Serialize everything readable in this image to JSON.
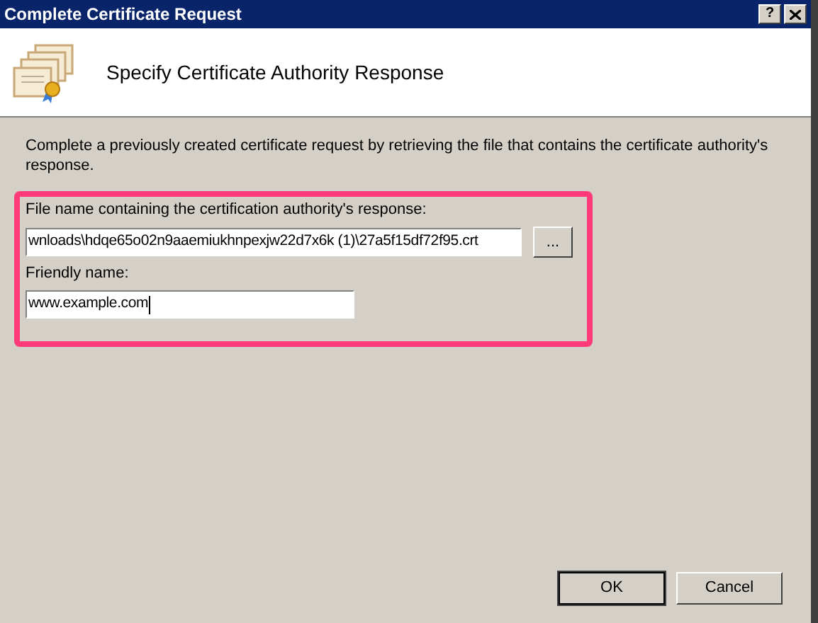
{
  "window": {
    "title": "Complete Certificate Request",
    "help_button": "?"
  },
  "header": {
    "title": "Specify Certificate Authority Response"
  },
  "description": "Complete a previously created certificate request by retrieving the file that contains the certificate authority's response.",
  "fields": [
    {
      "kind": "file",
      "label": "File name containing the certification authority's response:",
      "value": "wnloads\\hdqe65o02n9aaemiukhnpexjw22d7x6k (1)\\27a5f15df72f95.crt",
      "browse": "..."
    },
    {
      "kind": "text",
      "label": "Friendly name:",
      "value": "www.example.com"
    }
  ],
  "buttons": [
    {
      "label": "OK",
      "default": true
    },
    {
      "label": "Cancel",
      "default": false
    }
  ]
}
